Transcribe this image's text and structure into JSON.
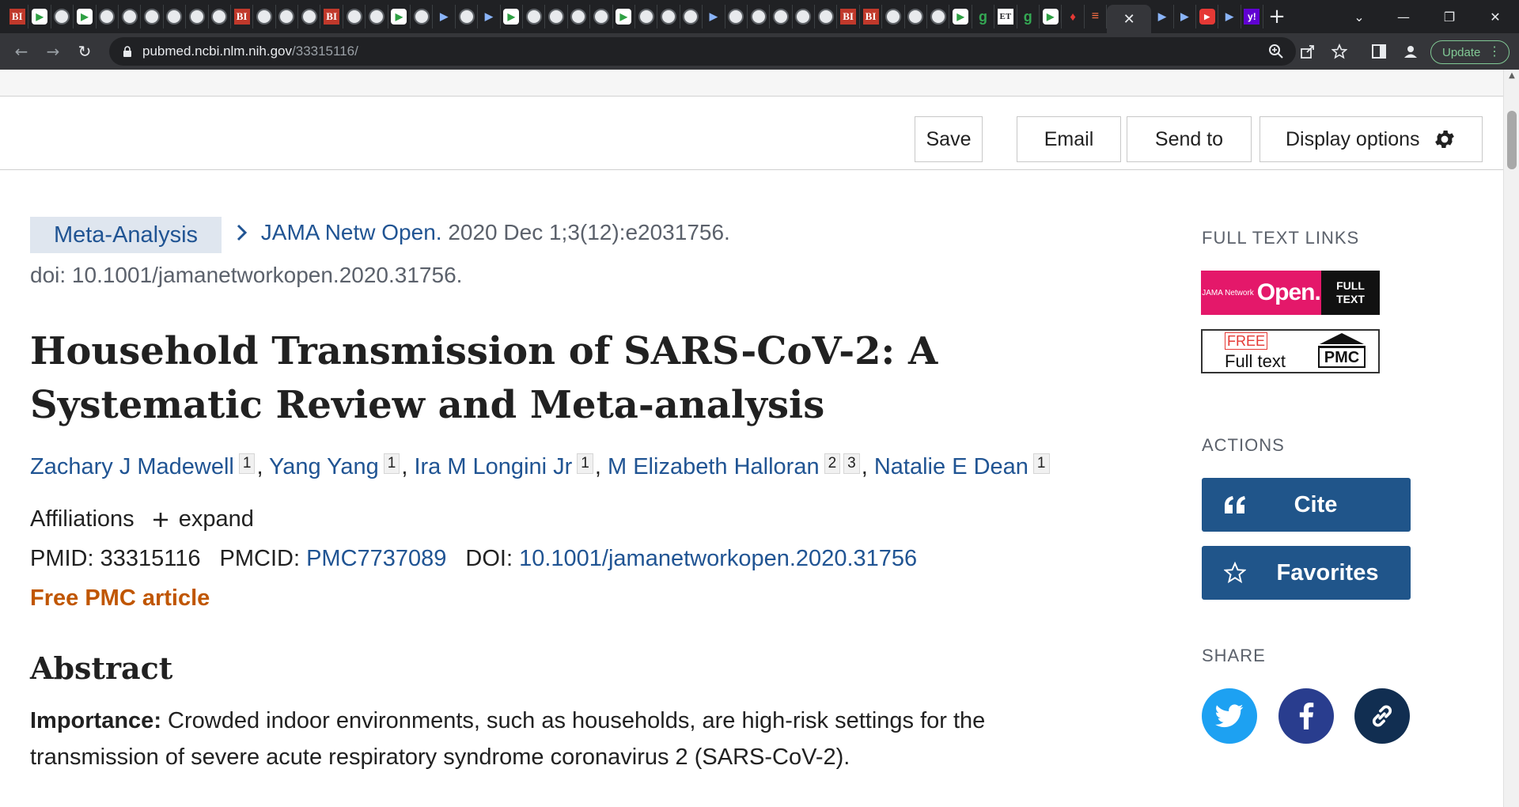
{
  "browser": {
    "tabs": [
      {
        "icon": "bi-icon",
        "glyph": "BI"
      },
      {
        "icon": "play-icon",
        "glyph": "▶"
      },
      {
        "icon": "globe-icon",
        "glyph": ""
      },
      {
        "icon": "play-icon",
        "glyph": "▶"
      },
      {
        "icon": "globe-icon",
        "glyph": ""
      },
      {
        "icon": "globe-icon",
        "glyph": ""
      },
      {
        "icon": "globe-icon",
        "glyph": ""
      },
      {
        "icon": "globe-icon",
        "glyph": ""
      },
      {
        "icon": "globe-icon",
        "glyph": ""
      },
      {
        "icon": "globe-icon",
        "glyph": ""
      },
      {
        "icon": "bi-icon",
        "glyph": "BI"
      },
      {
        "icon": "globe-icon",
        "glyph": ""
      },
      {
        "icon": "globe-icon",
        "glyph": ""
      },
      {
        "icon": "globe-icon",
        "glyph": ""
      },
      {
        "icon": "bi-icon",
        "glyph": "BI"
      },
      {
        "icon": "globe-icon",
        "glyph": ""
      },
      {
        "icon": "globe-icon",
        "glyph": ""
      },
      {
        "icon": "play-icon",
        "glyph": "▶"
      },
      {
        "icon": "globe-icon",
        "glyph": ""
      },
      {
        "icon": "ms-icon",
        "glyph": "▶"
      },
      {
        "icon": "globe-icon",
        "glyph": ""
      },
      {
        "icon": "ms-icon",
        "glyph": "▶"
      },
      {
        "icon": "play-icon",
        "glyph": "▶"
      },
      {
        "icon": "globe-icon",
        "glyph": ""
      },
      {
        "icon": "globe-icon",
        "glyph": ""
      },
      {
        "icon": "globe-icon",
        "glyph": ""
      },
      {
        "icon": "globe-icon",
        "glyph": ""
      },
      {
        "icon": "play-icon",
        "glyph": "▶"
      },
      {
        "icon": "globe-icon",
        "glyph": ""
      },
      {
        "icon": "globe-icon",
        "glyph": ""
      },
      {
        "icon": "globe-icon",
        "glyph": ""
      },
      {
        "icon": "ms-icon",
        "glyph": "▶"
      },
      {
        "icon": "globe-icon",
        "glyph": ""
      },
      {
        "icon": "globe-icon",
        "glyph": ""
      },
      {
        "icon": "globe-icon",
        "glyph": ""
      },
      {
        "icon": "globe-icon",
        "glyph": ""
      },
      {
        "icon": "globe-icon",
        "glyph": ""
      },
      {
        "icon": "bi-icon",
        "glyph": "BI"
      },
      {
        "icon": "bi-icon",
        "glyph": "BI"
      },
      {
        "icon": "globe-icon",
        "glyph": ""
      },
      {
        "icon": "globe-icon",
        "glyph": ""
      },
      {
        "icon": "globe-icon",
        "glyph": ""
      },
      {
        "icon": "play-icon",
        "glyph": "▶"
      },
      {
        "icon": "g-icon",
        "glyph": "g"
      },
      {
        "icon": "et-icon",
        "glyph": "ET"
      },
      {
        "icon": "g-icon",
        "glyph": "g"
      },
      {
        "icon": "play-icon",
        "glyph": "▶"
      },
      {
        "icon": "red-icon",
        "glyph": "♦"
      },
      {
        "icon": "orange-icon",
        "glyph": "≡"
      }
    ],
    "tabs_after": [
      {
        "icon": "ms-icon",
        "glyph": "▶"
      },
      {
        "icon": "ms-icon",
        "glyph": "▶"
      },
      {
        "icon": "youtube-icon",
        "glyph": "▶"
      },
      {
        "icon": "ms-icon",
        "glyph": "▶"
      },
      {
        "icon": "yahoo-icon",
        "glyph": "y!"
      }
    ],
    "active_tab_close": "✕",
    "new_tab": "+",
    "url_host": "pubmed.ncbi.nlm.nih.gov",
    "url_path": "/33315116/",
    "update_label": "Update",
    "update_menu": "⋮",
    "window_controls": {
      "list": "⌄",
      "minimize": "—",
      "restore": "❐",
      "close": "✕"
    },
    "nav": {
      "back": "←",
      "forward": "→",
      "reload": "↻"
    }
  },
  "actions_bar": {
    "save": "Save",
    "email": "Email",
    "send_to": "Send to",
    "display_options": "Display options"
  },
  "article": {
    "publication_type": "Meta-Analysis",
    "journal": "JAMA Netw Open.",
    "citation": " 2020 Dec 1;3(12):e2031756.",
    "doi_line": "doi: 10.1001/jamanetworkopen.2020.31756.",
    "title": "Household Transmission of SARS-CoV-2: A Systematic Review and Meta-analysis",
    "authors": [
      {
        "name": "Zachary J Madewell",
        "affils": [
          "1"
        ]
      },
      {
        "name": "Yang Yang",
        "affils": [
          "1"
        ]
      },
      {
        "name": "Ira M Longini Jr",
        "affils": [
          "1"
        ]
      },
      {
        "name": "M Elizabeth Halloran",
        "affils": [
          "2",
          "3"
        ]
      },
      {
        "name": "Natalie E Dean",
        "affils": [
          "1"
        ]
      }
    ],
    "affiliations_label": "Affiliations",
    "expand_label": "expand",
    "pmid_label": "PMID: ",
    "pmid": "33315116",
    "pmcid_label": "PMCID: ",
    "pmcid": "PMC7737089",
    "doi_label": "DOI: ",
    "doi": "10.1001/jamanetworkopen.2020.31756",
    "free_pmc": "Free PMC article",
    "abstract_heading": "Abstract",
    "abstract_importance_label": "Importance:",
    "abstract_importance_text": " Crowded indoor environments, such as households, are high-risk settings for the transmission of severe acute respiratory syndrome coronavirus 2 (SARS-CoV-2)."
  },
  "sidebar": {
    "full_text_links_heading": "FULL TEXT LINKS",
    "jama_badge": {
      "small": "JAMA Network",
      "big": "Open.",
      "right_line1": "FULL",
      "right_line2": "TEXT"
    },
    "pmc_badge": {
      "free": "FREE",
      "full": "Full text",
      "logo": "PMC"
    },
    "actions_heading": "ACTIONS",
    "cite": "Cite",
    "favorites": "Favorites",
    "share_heading": "SHARE",
    "colors": {
      "twitter": "#1da1f2",
      "facebook": "#293d8e",
      "link": "#112e51",
      "button": "#20558a"
    }
  }
}
